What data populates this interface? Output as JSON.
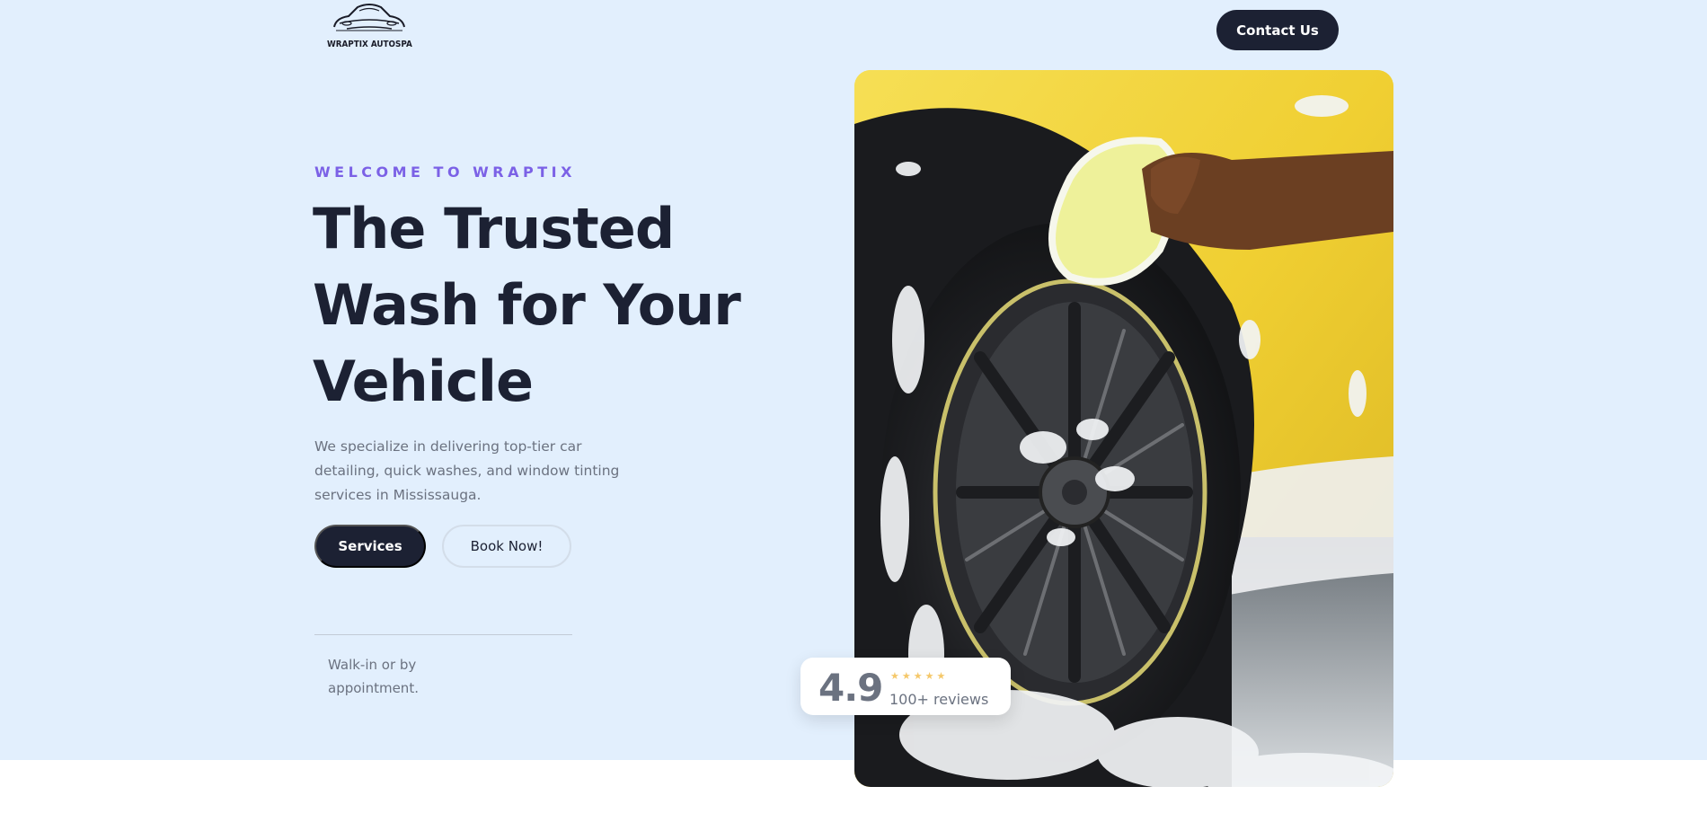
{
  "header": {
    "logo_text": "WRAPTIX AUTOSPA",
    "contact_label": "Contact Us"
  },
  "hero": {
    "eyebrow": "WELCOME TO WRAPTIX",
    "headline_lines": [
      "The Trusted",
      "Wash for Your",
      "Vehicle"
    ],
    "description": "We specialize in delivering top-tier car detailing, quick washes, and window tinting services in Mississauga.",
    "services_label": "Services",
    "book_label": "Book Now!",
    "availability": "Walk-in or by appointment."
  },
  "rating": {
    "score": "4.9",
    "stars_value": 5,
    "stars_max": 5,
    "reviews": "100+ reviews"
  },
  "photo": {
    "subject": "car-wash-photo"
  },
  "colors": {
    "hero_bg": "#e2effd",
    "dark": "#1c2133",
    "accent": "#7b61e6",
    "star": "#f5c86a"
  }
}
